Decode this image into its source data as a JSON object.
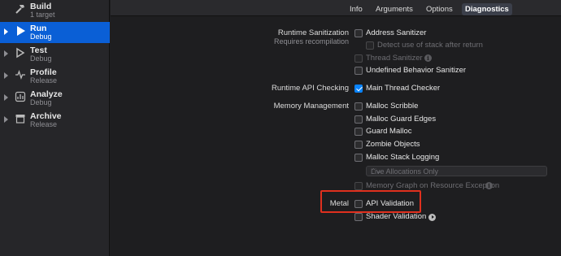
{
  "sidebar": {
    "items": [
      {
        "title": "Build",
        "subtitle": "1 target",
        "icon": "hammer-icon"
      },
      {
        "title": "Run",
        "subtitle": "Debug",
        "icon": "play-icon"
      },
      {
        "title": "Test",
        "subtitle": "Debug",
        "icon": "test-icon"
      },
      {
        "title": "Profile",
        "subtitle": "Release",
        "icon": "waveform-icon"
      },
      {
        "title": "Analyze",
        "subtitle": "Debug",
        "icon": "analyze-icon"
      },
      {
        "title": "Archive",
        "subtitle": "Release",
        "icon": "archive-icon"
      }
    ]
  },
  "tabs": [
    "Info",
    "Arguments",
    "Options",
    "Diagnostics"
  ],
  "active_tab": "Diagnostics",
  "sections": {
    "runtime_sanitization": {
      "label": "Runtime Sanitization",
      "sublabel": "Requires recompilation",
      "address_sanitizer": "Address Sanitizer",
      "detect_stack": "Detect use of stack after return",
      "thread_sanitizer": "Thread Sanitizer",
      "ub_sanitizer": "Undefined Behavior Sanitizer"
    },
    "runtime_api": {
      "label": "Runtime API Checking",
      "main_thread_checker": "Main Thread Checker"
    },
    "memory": {
      "label": "Memory Management",
      "malloc_scribble": "Malloc Scribble",
      "malloc_guard_edges": "Malloc Guard Edges",
      "guard_malloc": "Guard Malloc",
      "zombie_objects": "Zombie Objects",
      "malloc_stack_logging": "Malloc Stack Logging",
      "live_allocations": "Live Allocations Only",
      "memory_graph": "Memory Graph on Resource Exception"
    },
    "metal": {
      "label": "Metal",
      "api_validation": "API Validation",
      "shader_validation": "Shader Validation"
    }
  },
  "colors": {
    "accent": "#0a5fd6",
    "checked": "#0a84ff",
    "highlight": "#e0301e"
  }
}
